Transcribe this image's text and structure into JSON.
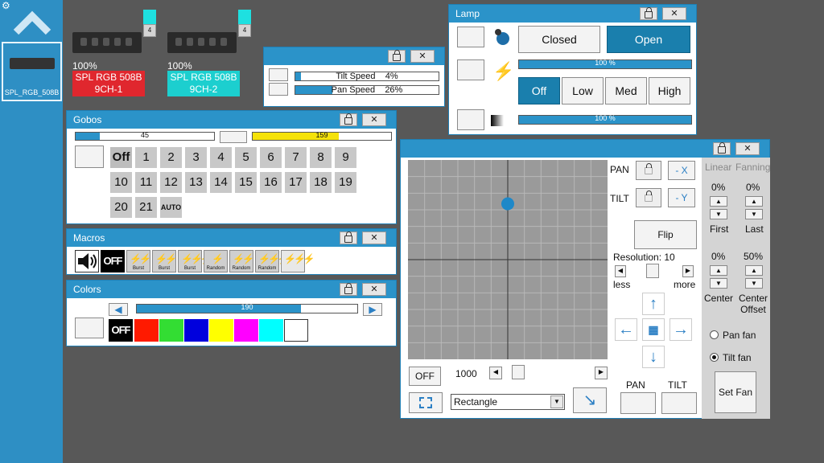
{
  "sidebar": {
    "fixture_label": "SPL_RGB_508B"
  },
  "fixtures": [
    {
      "percent": "100%",
      "name_line1": "SPL RGB 508B",
      "name_line2": "9CH-1",
      "num": "4",
      "color": "#e0272e"
    },
    {
      "percent": "100%",
      "name_line1": "SPL RGB 508B",
      "name_line2": "9CH-2",
      "num": "4",
      "color": "#1ccfcf"
    }
  ],
  "speed": {
    "tilt_label": "Tilt Speed",
    "tilt_value": "4%",
    "tilt_level": 4,
    "pan_label": "Pan Speed",
    "pan_value": "26%",
    "pan_level": 26
  },
  "lamp": {
    "title": "Lamp",
    "closed": "Closed",
    "open": "Open",
    "intensity1": "100 %",
    "off": "Off",
    "low": "Low",
    "med": "Med",
    "high": "High",
    "intensity2": "100 %"
  },
  "gobos": {
    "title": "Gobos",
    "left_value": "45",
    "left_level": 45,
    "right_value": "159",
    "right_level": 159,
    "off": "Off",
    "items": [
      "1",
      "2",
      "3",
      "4",
      "5",
      "6",
      "7",
      "8",
      "9",
      "10",
      "11",
      "12",
      "13",
      "14",
      "15",
      "16",
      "17",
      "18",
      "19",
      "20",
      "21"
    ],
    "auto": "AUTO"
  },
  "macros": {
    "title": "Macros",
    "off": "OFF",
    "items": [
      "",
      "Burst",
      "Burst",
      "Burst",
      "Random",
      "Random",
      "Random",
      ""
    ]
  },
  "colors": {
    "title": "Colors",
    "value": "190",
    "level": 190,
    "off": "OFF",
    "swatches": [
      "#ff1a00",
      "#33dd33",
      "#0000dd",
      "#ffff00",
      "#ff00ff",
      "#00ffff",
      "#ffffff"
    ]
  },
  "pantilt": {
    "pan": "PAN",
    "tilt": "TILT",
    "minus_x": "- X",
    "minus_y": "- Y",
    "flip": "Flip",
    "resolution": "Resolution: 10",
    "less": "less",
    "more": "more",
    "off": "OFF",
    "speed_value": "1000",
    "shape": "Rectangle",
    "pan_bottom": "PAN",
    "tilt_bottom": "TILT",
    "dot_pan": 0.5,
    "dot_tilt": 0.78
  },
  "fanning": {
    "linear": "Linear",
    "fanning": "Fanning",
    "first_val": "0%",
    "last_val": "0%",
    "first": "First",
    "last": "Last",
    "center_val": "0%",
    "offset_val": "50%",
    "center": "Center",
    "center_offset_1": "Center",
    "center_offset_2": "Offset",
    "pan_fan": "Pan fan",
    "tilt_fan": "Tilt fan",
    "set_fan": "Set Fan"
  }
}
